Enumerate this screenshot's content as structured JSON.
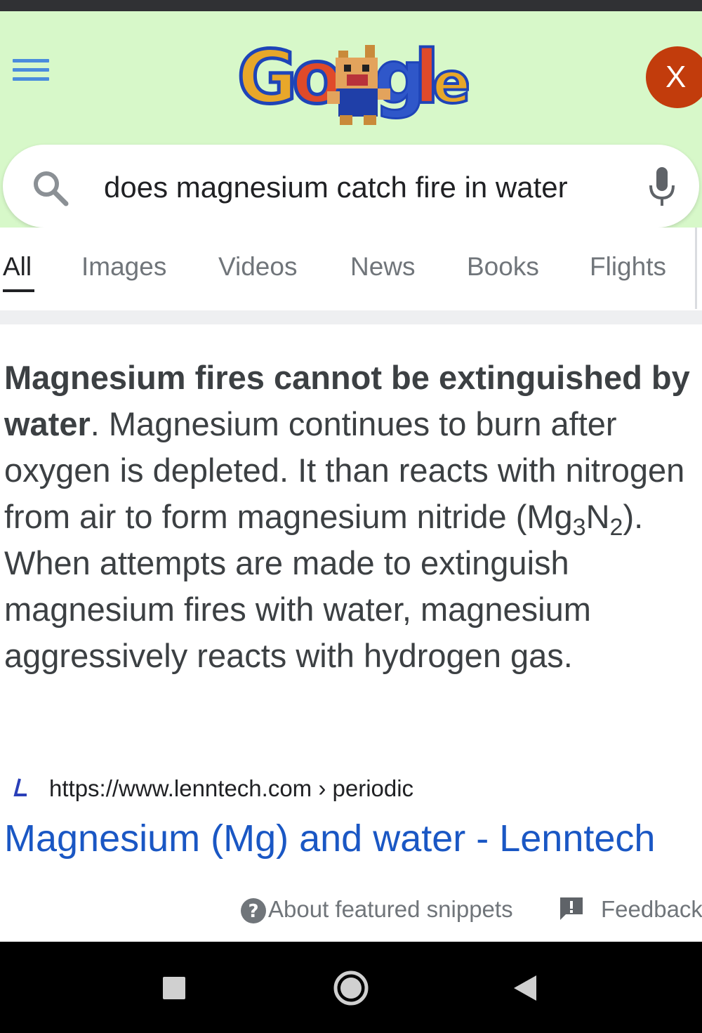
{
  "header": {
    "logo_alt": "Google",
    "account_initial": "X",
    "menu_icon": "hamburger-menu-icon"
  },
  "search": {
    "query": "does magnesium catch fire in water",
    "search_icon": "search-icon",
    "mic_icon": "microphone-icon"
  },
  "tabs": [
    {
      "label": "All",
      "active": true
    },
    {
      "label": "Images",
      "active": false
    },
    {
      "label": "Videos",
      "active": false
    },
    {
      "label": "News",
      "active": false
    },
    {
      "label": "Books",
      "active": false
    },
    {
      "label": "Flights",
      "active": false
    }
  ],
  "snippet": {
    "bold_text": "Magnesium fires cannot be extinguished by water",
    "text_part1": ". Magnesium continues to burn after oxygen is depleted. It than reacts with nitrogen from air to form magnesium nitride (Mg",
    "sub1": "3",
    "text_part2": "N",
    "sub2": "2",
    "text_part3": "). When attempts are made to extinguish magnesium fires with water, magnesium aggressively reacts with hydrogen gas."
  },
  "source": {
    "url": "https://www.lenntech.com › periodic",
    "title": "Magnesium (Mg) and water - Lenntech",
    "favicon_icon": "lenntech-favicon-icon"
  },
  "footer": {
    "about_label": "About featured snippets",
    "feedback_label": "Feedback"
  },
  "colors": {
    "header_bg": "#d7f8c9",
    "link_blue": "#1a57c4",
    "avatar_bg": "#c23c0c"
  }
}
